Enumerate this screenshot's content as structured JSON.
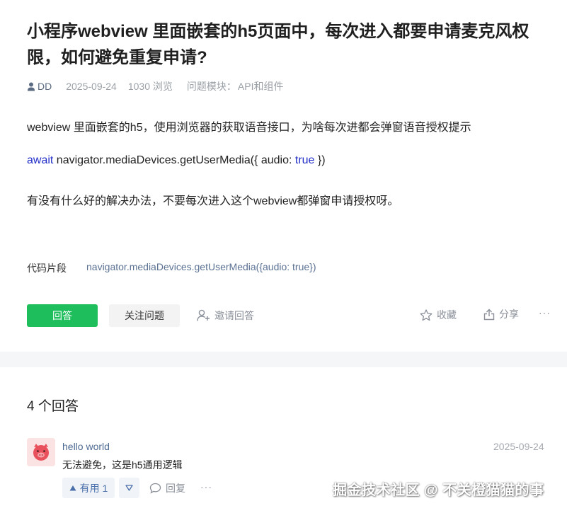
{
  "question": {
    "title": "小程序webview 里面嵌套的h5页面中，每次进入都要申请麦克风权限，如何避免重复申请?",
    "author": "DD",
    "date": "2025-09-24",
    "views": "1030 浏览",
    "module_label": "问题模块：",
    "module_value": "API和组件",
    "body_line1": "webview 里面嵌套的h5，使用浏览器的获取语音接口，为啥每次进都会弹窗语音授权提示",
    "code_await": "await",
    "code_mid": " navigator.mediaDevices.getUserMedia({ audio: ",
    "code_true": "true",
    "code_end": " })",
    "body_line3": "有没有什么好的解决办法，不要每次进入这个webview都弹窗申请授权呀。",
    "snippet_label": "代码片段",
    "snippet_code": "navigator.mediaDevices.getUserMedia({audio: true})"
  },
  "actions": {
    "answer": "回答",
    "follow": "关注问题",
    "invite": "邀请回答",
    "favorite": "收藏",
    "share": "分享",
    "more": "···"
  },
  "answers": {
    "count_label": "4 个回答",
    "items": [
      {
        "user": "hello world",
        "date": "2025-09-24",
        "text": "无法避免，这是h5通用逻辑",
        "useful": "有用 1",
        "reply": "回复",
        "more": "···"
      }
    ]
  },
  "watermark": "掘金技术社区 @ 不关橙猫猫的事",
  "colors": {
    "primary": "#1fbe5c",
    "link": "#4d6b92",
    "keyword": "#2430c9"
  }
}
